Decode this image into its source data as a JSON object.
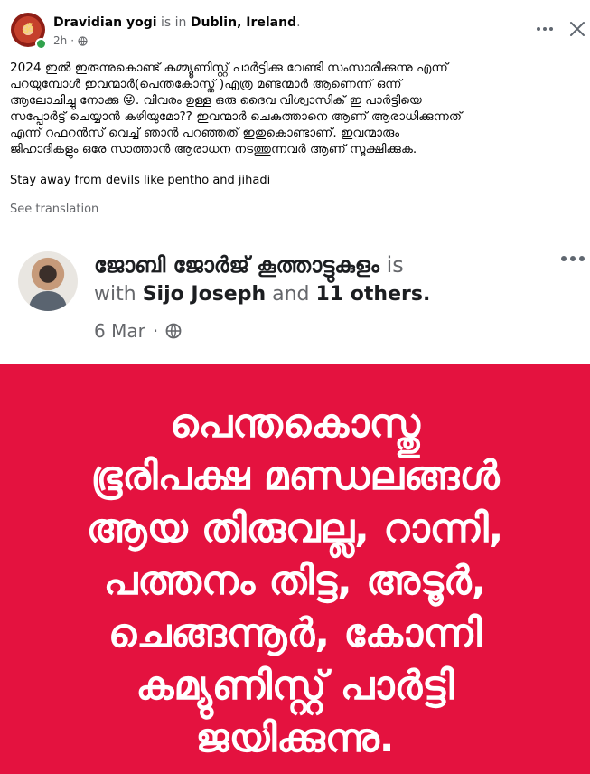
{
  "post": {
    "author": "Dravidian yogi",
    "is_in": "is in",
    "location": "Dublin, Ireland",
    "time": "2h",
    "dot": "·",
    "text_lines": [
      "2024 ഇൽ ഇരുന്നുകൊണ്ട് കമ്മ്യൂണിസ്റ്റ് പാർട്ടിക്കു വേണ്ടി സംസാരിക്കുന്നു എന്ന്",
      "പറയുമ്പോൾ ഇവന്മാർ(പെന്തകോസ്ത് )എത്ര മണ്ടന്മാർ ആണെന്ന് ഒന്ന്",
      "ആലോചിച്ചു നോക്കു 😜. വിവരം ഉള്ള ഒരു ദൈവ വിശ്വാസിക് ഇ പാർട്ടിയെ",
      "സപ്പോർട്ട് ചെയ്യാൻ കഴിയുമോ?? ഇവന്മാർ ചെകുത്താനെ ആണ് ആരാധിക്കുന്നത്",
      "എന്ന് റഫറൻസ് വെച്ച് ഞാൻ പറഞ്ഞത് ഇതുകൊണ്ടാണ്. ഇവന്മാരും",
      "ജിഹാദികളും ഒരേ സാത്താൻ ആരാധന നടത്തുന്നവർ ആണ് സൂക്ഷിക്കുക."
    ],
    "text_extra": "Stay away from devils like pentho and jihadi",
    "see_translation": "See translation"
  },
  "shared": {
    "author": "ജോബി ജോർജ് കൂത്താട്ടുകുളം",
    "is": "is",
    "with": "with",
    "tagged": "Sijo Joseph",
    "and": "and",
    "others": "11 others.",
    "date": "6 Mar",
    "dot": "·"
  },
  "banner": {
    "background": "#e4123f",
    "lines": [
      "പെന്തകൊസ്തു",
      "ഭൂരിപക്ഷ മണ്ഡലങ്ങൾ",
      "ആയ തിരുവല്ല, റാന്നി,",
      "പത്തനം തിട്ട, അടൂർ,",
      "ചെങ്ങന്നൂർ, കോന്നി",
      "കമ്യുണിസ്റ്റ് പാർട്ടി",
      "ജയിക്കുന്നു."
    ]
  },
  "icons": {
    "globe": "globe-icon",
    "more": "more-options-icon",
    "close": "close-icon"
  }
}
